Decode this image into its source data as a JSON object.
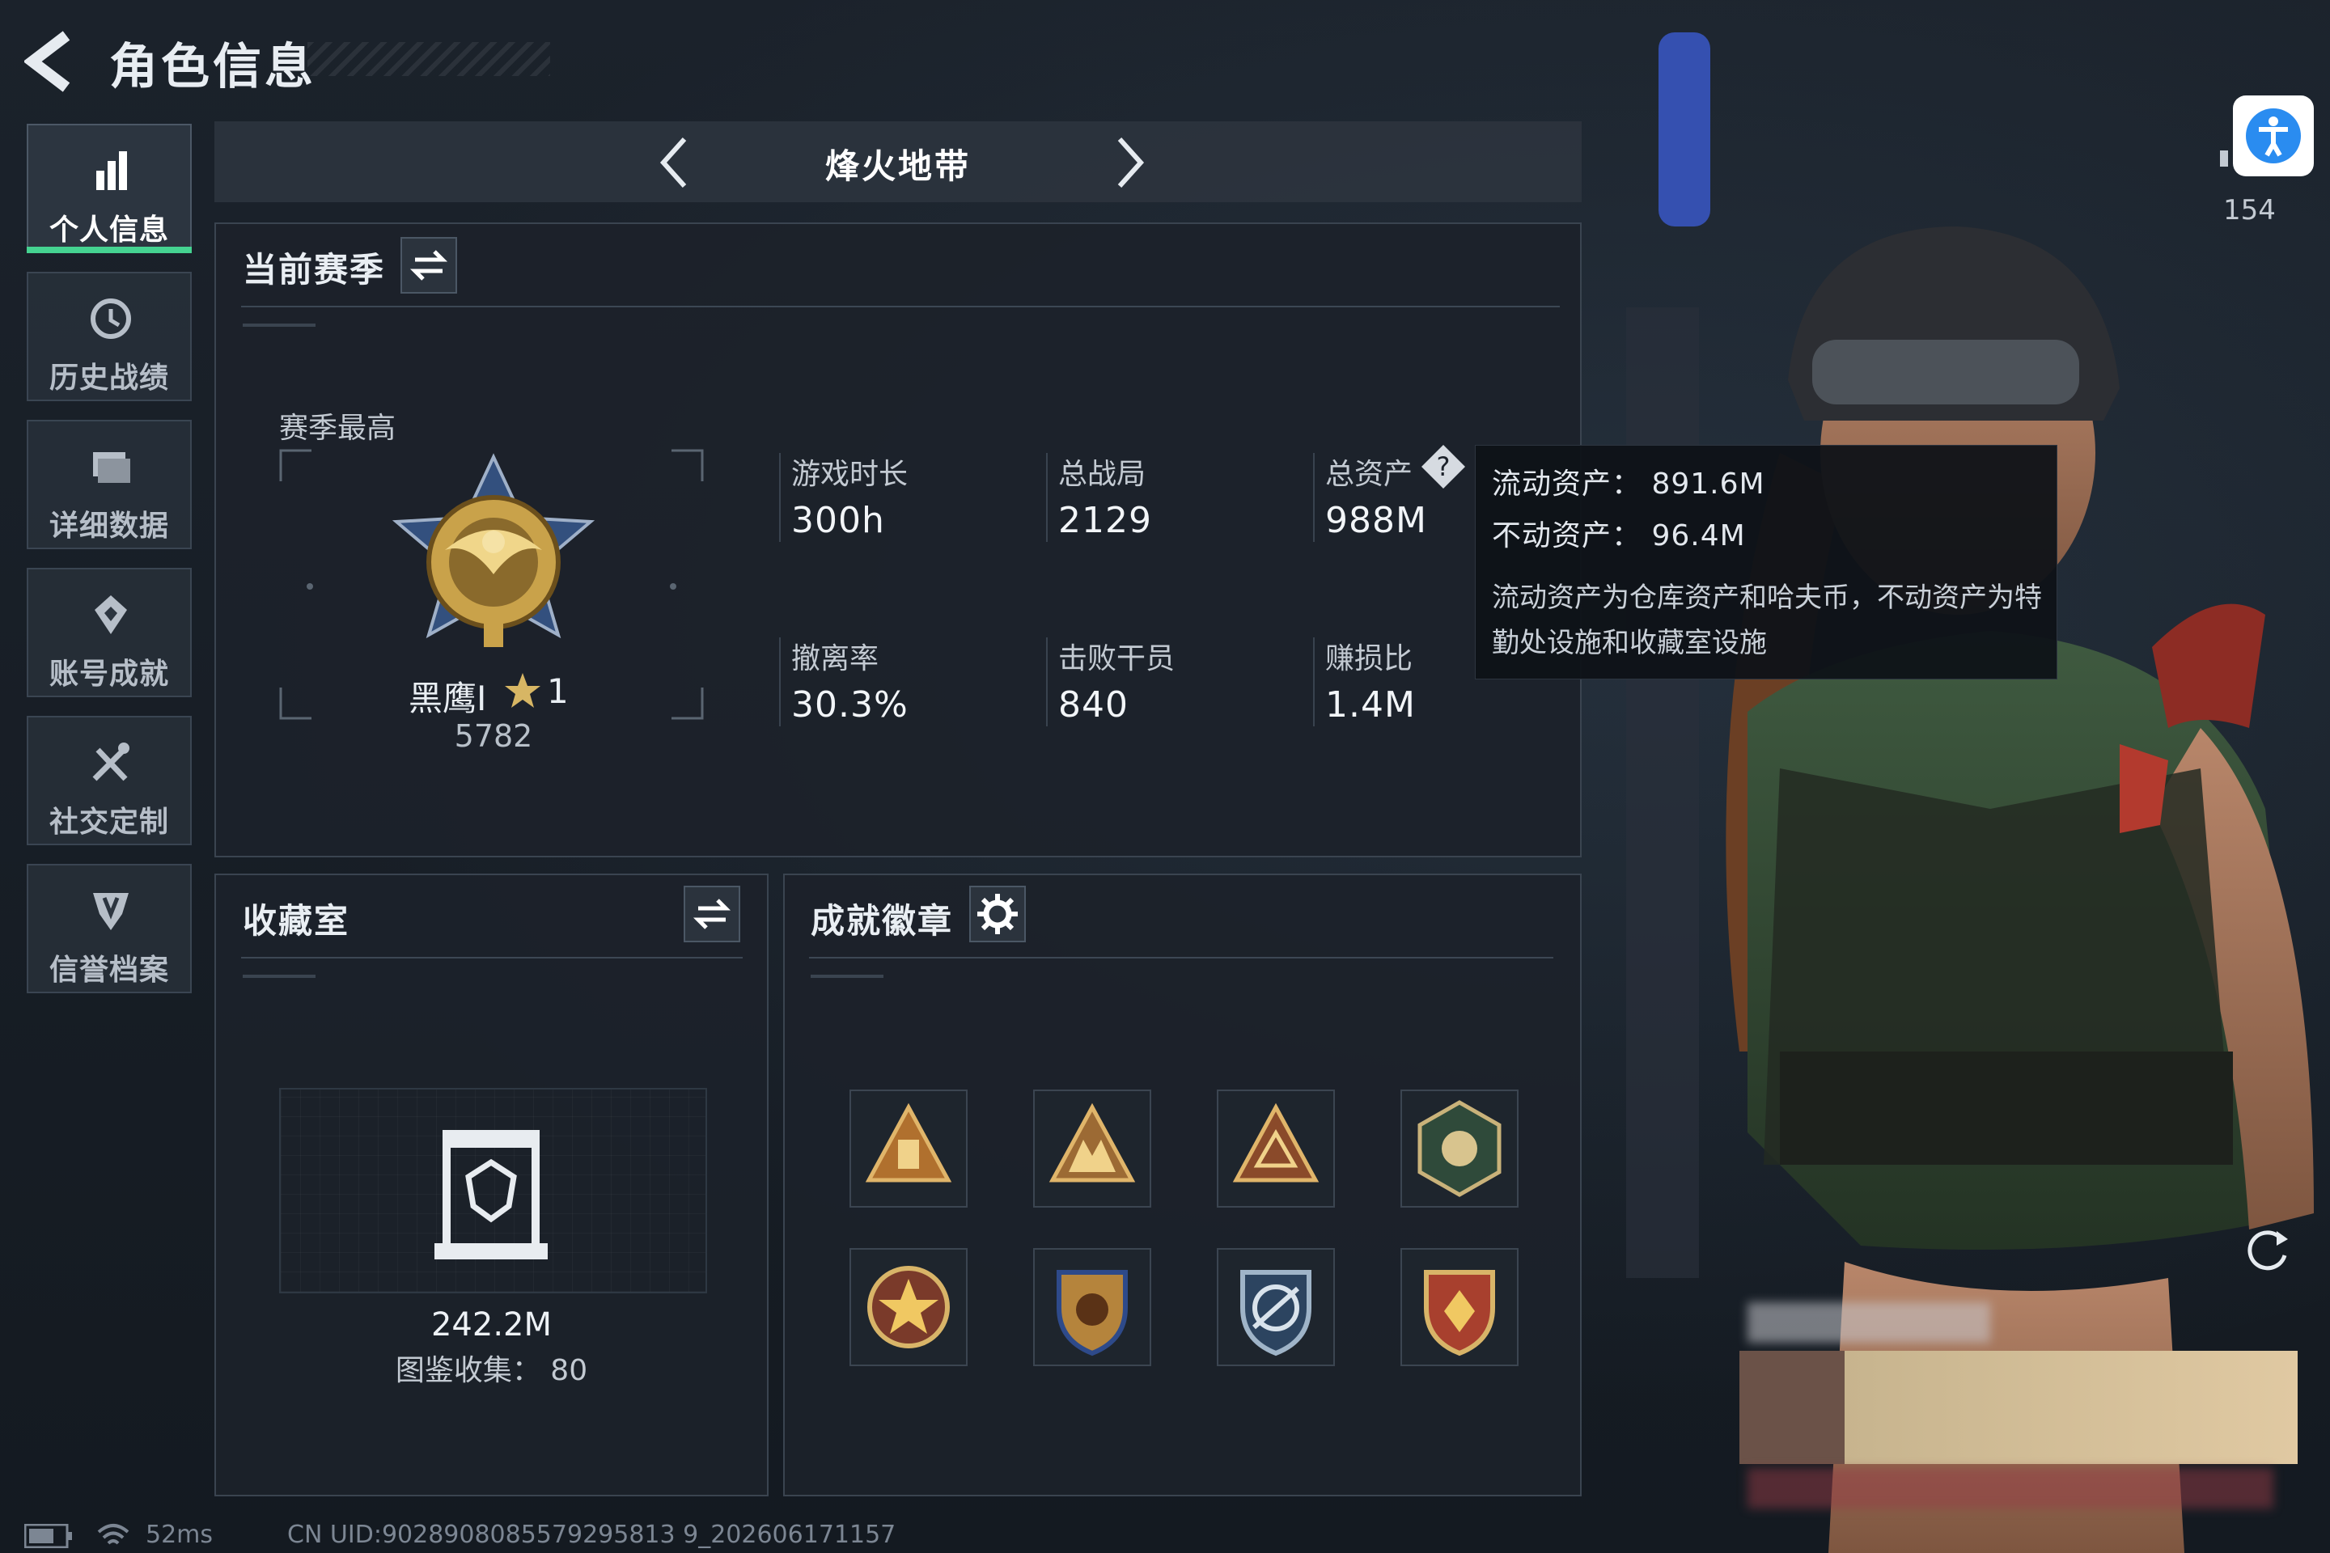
{
  "header": {
    "title": "角色信息"
  },
  "sidebar": {
    "items": [
      {
        "label": "个人信息",
        "active": true,
        "icon": "bar-chart-icon"
      },
      {
        "label": "历史战绩",
        "active": false,
        "icon": "clock-icon"
      },
      {
        "label": "详细数据",
        "active": false,
        "icon": "folder-icon"
      },
      {
        "label": "账号成就",
        "active": false,
        "icon": "achievement-icon"
      },
      {
        "label": "社交定制",
        "active": false,
        "icon": "tools-icon"
      },
      {
        "label": "信誉档案",
        "active": false,
        "icon": "shield-icon"
      }
    ]
  },
  "mode": {
    "title": "烽火地带"
  },
  "season": {
    "title": "当前赛季",
    "best_label": "赛季最高",
    "rank_name": "黑鹰I",
    "rank_stars": "1",
    "rank_score": "5782",
    "stats": [
      {
        "label": "游戏时长",
        "value": "300h"
      },
      {
        "label": "总战局",
        "value": "2129"
      },
      {
        "label": "总资产",
        "value": "988M"
      },
      {
        "label": "撤离率",
        "value": "30.3%"
      },
      {
        "label": "击败干员",
        "value": "840"
      },
      {
        "label": "赚损比",
        "value": "1.4M"
      }
    ]
  },
  "tooltip": {
    "liquid": "流动资产：  891.6M",
    "fixed": "不动资产：  96.4M",
    "desc": "流动资产为仓库资产和哈夫币，不动资产为特勤处设施和收藏室设施"
  },
  "collection": {
    "title": "收藏室",
    "value": "242.2M",
    "codex": "图鉴收集：  80"
  },
  "badges": {
    "title": "成就徽章",
    "items": [
      "triangle-badge-1",
      "triangle-badge-2",
      "triangle-badge-3",
      "hex-badge",
      "star-badge",
      "shield-badge-1",
      "shield-badge-2",
      "shield-badge-3"
    ]
  },
  "player_count": "154",
  "status": {
    "ping": "52ms",
    "uid": "CN UID:9028908085579295813 9_202606171157"
  },
  "colors": {
    "accent_green": "#45d391",
    "accessibility_blue": "#2a8cf0",
    "gold": "#c9a24a"
  }
}
